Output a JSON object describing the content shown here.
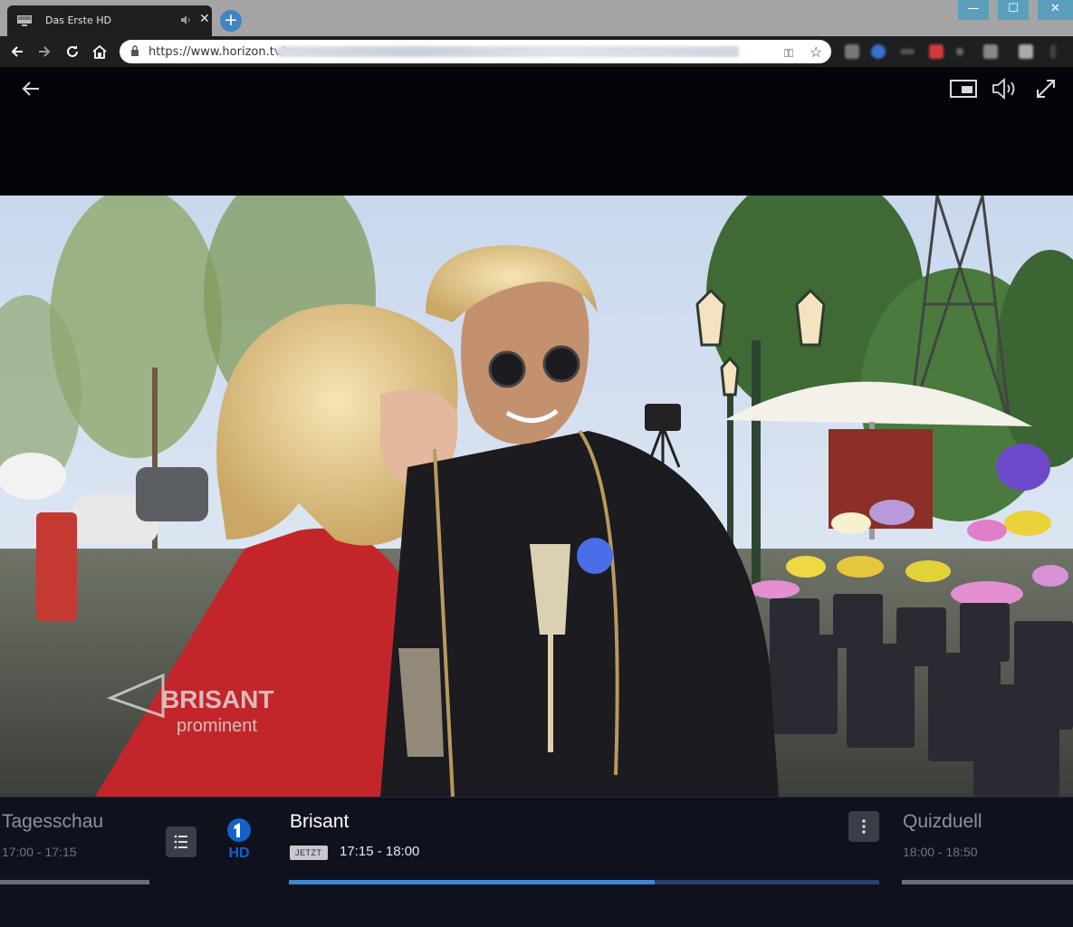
{
  "browser": {
    "tab_title": "Das Erste HD",
    "tab_close": "✕",
    "new_tab": "+",
    "window_controls": {
      "minimize": "—",
      "maximize": "☐",
      "close": "✕"
    },
    "url": "https://www.horizon.tv/"
  },
  "player": {
    "icons": [
      "back-arrow-icon",
      "picture-in-picture-icon",
      "volume-icon",
      "fullscreen-icon"
    ]
  },
  "video": {
    "watermark_line1": "BRISANT",
    "watermark_line2": "prominent"
  },
  "epg": {
    "previous": {
      "title": "Tagesschau",
      "time": "17:00 - 17:15"
    },
    "channel_logo_text": "HD",
    "current": {
      "title": "Brisant",
      "badge": "JETZT",
      "time": "17:15 - 18:00",
      "progress": 0.62
    },
    "next": {
      "title": "Quizduell",
      "time": "18:00 - 18:50"
    },
    "colors": {
      "accent": "#3d86d6",
      "channel_blue": "#1262c9"
    }
  }
}
